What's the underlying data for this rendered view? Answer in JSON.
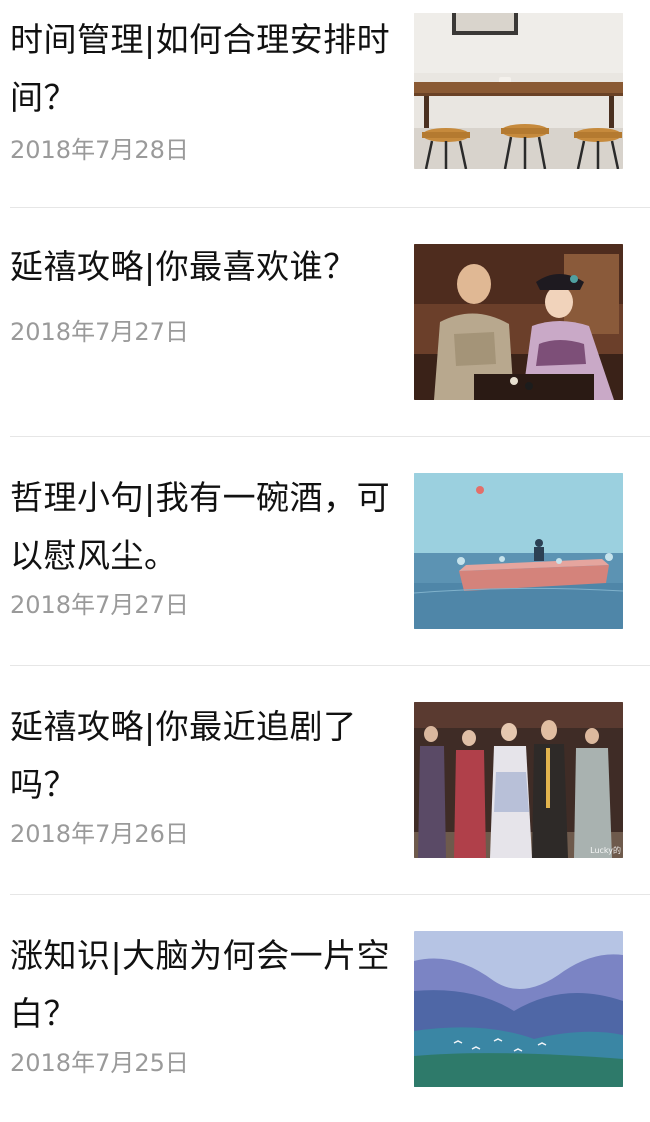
{
  "articles": [
    {
      "title": "时间管理|如何合理安排时间？",
      "date": "2018年7月28日",
      "thumbnail": "cafe-stools-photo"
    },
    {
      "title": "延禧攻略|你最喜欢谁？",
      "date": "2018年7月27日",
      "thumbnail": "palace-drama-scene-photo"
    },
    {
      "title": "哲理小句|我有一碗酒，可以慰风尘。",
      "date": "2018年7月27日",
      "thumbnail": "seaside-illustration"
    },
    {
      "title": "延禧攻略|你最近追剧了吗？",
      "date": "2018年7月26日",
      "thumbnail": "palace-drama-cast-photo",
      "thumbnail_watermark": "Lucky的"
    },
    {
      "title": "涨知识|大脑为何会一片空白？",
      "date": "2018年7月25日",
      "thumbnail": "blue-mountains-painting"
    }
  ]
}
